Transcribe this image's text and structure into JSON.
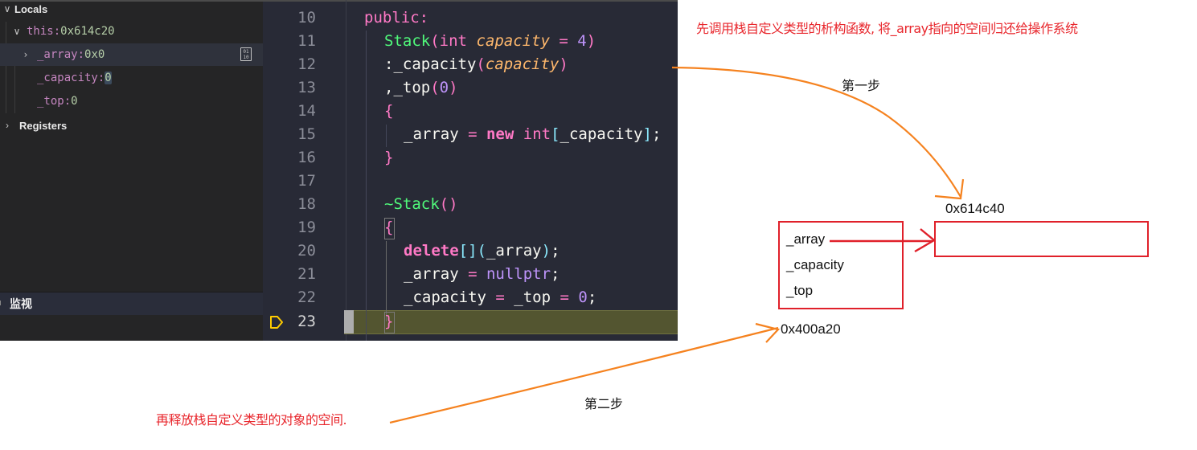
{
  "debug_panel": {
    "locals_label": "Locals",
    "variables": [
      {
        "name": "this",
        "sep": ": ",
        "value": "0x614c20",
        "expanded": true
      },
      {
        "name": "_array",
        "sep": ": ",
        "value": "0x0",
        "expanded": false,
        "selected": true
      },
      {
        "name": "_capacity",
        "sep": ": ",
        "value": "0"
      },
      {
        "name": "_top",
        "sep": ": ",
        "value": "0"
      }
    ],
    "registers_label": "Registers",
    "watch_label": "监视",
    "icons": {
      "locals_toggle": "chevron-down-icon",
      "registers_toggle": "chevron-right-icon",
      "view_binary": "binary-data-icon"
    }
  },
  "editor": {
    "current_line": 23,
    "lines": [
      {
        "n": "10"
      },
      {
        "n": "11"
      },
      {
        "n": "12"
      },
      {
        "n": "13"
      },
      {
        "n": "14"
      },
      {
        "n": "15"
      },
      {
        "n": "16"
      },
      {
        "n": "17"
      },
      {
        "n": "18"
      },
      {
        "n": "19"
      },
      {
        "n": "20"
      },
      {
        "n": "21"
      },
      {
        "n": "22"
      },
      {
        "n": "23"
      }
    ],
    "tokens": {
      "l10": {
        "kw": "public:"
      },
      "l11": {
        "fn": "Stack",
        "p1": "(",
        "ty": "int",
        "sp": " ",
        "param": "capacity",
        "eq": " = ",
        "num": "4",
        "p2": ")"
      },
      "l12": {
        "pre": ":_capacity",
        "p1": "(",
        "param": "capacity",
        "p2": ")"
      },
      "l13": {
        "pre": ",_top",
        "p1": "(",
        "num": "0",
        "p2": ")"
      },
      "l14": {
        "brace": "{"
      },
      "l15": {
        "pre": "_array",
        "eq": " = ",
        "kw": "new",
        "sp": " ",
        "ty": "int",
        "b1": "[",
        "mid": "_capacity",
        "b2": "]",
        "end": ";"
      },
      "l16": {
        "brace": "}"
      },
      "l18": {
        "fn": "~Stack",
        "paren": "()"
      },
      "l19": {
        "brace": "{"
      },
      "l20": {
        "kw": "delete",
        "b": "[]",
        "p1": "(",
        "mid": "_array",
        "p2": ")",
        "end": ";"
      },
      "l21": {
        "pre": "_array",
        "eq": " = ",
        "kw": "nullptr",
        "end": ";"
      },
      "l22": {
        "pre": "_capacity",
        "eq1": " = ",
        "mid": "_top",
        "eq2": " = ",
        "num": "0",
        "end": ";"
      },
      "l23": {
        "brace": "}"
      }
    },
    "breakpoint_icon": "debug-stackframe-icon"
  },
  "annotations": {
    "step1_note": "先调用栈自定义类型的析构函数, 将_array指向的空间归还给操作系统",
    "step1_label": "第一步",
    "step2_note": "再释放栈自定义类型的对象的空间.",
    "step2_label": "第二步",
    "object_address": "0x400a20",
    "heap_address": "0x614c40",
    "object_fields": [
      "_array",
      "_capacity",
      "_top"
    ],
    "colors": {
      "note_red": "#e8262c",
      "arrow_orange": "#f5821f",
      "box_red": "#e0202a"
    }
  }
}
